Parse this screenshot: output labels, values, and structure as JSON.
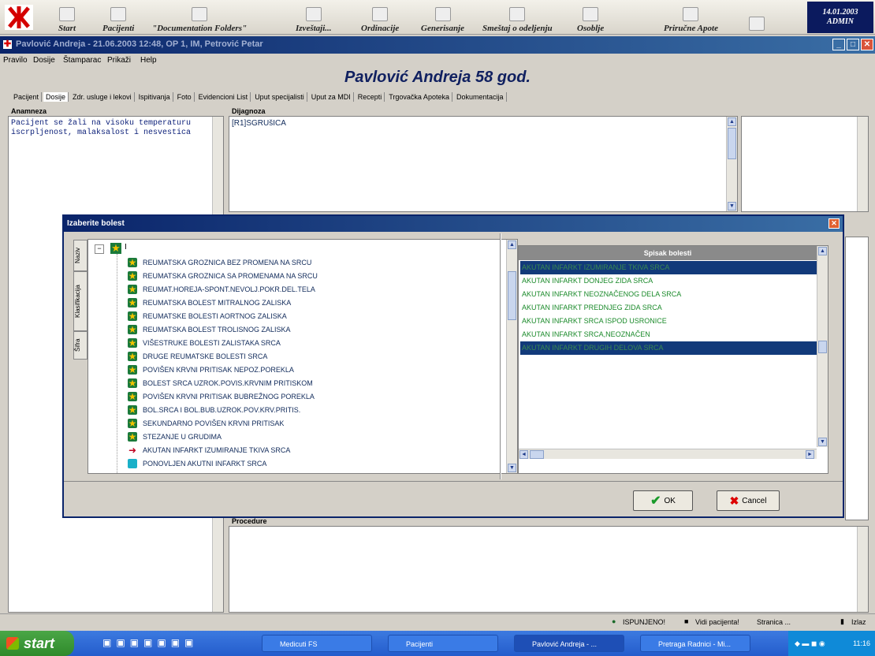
{
  "toolbar": {
    "items": [
      "Start",
      "Pacijenti",
      "\"Documentation Folders\"",
      "Izveštaji...",
      "Ordinacije",
      "Generisanje",
      "Smeštaj o odeljenju",
      "Osoblje",
      "Priručne Apote"
    ],
    "date": "14.01.2003",
    "user": "ADMIN"
  },
  "window": {
    "title": "Pavlović Andreja - 21.06.2003 12:48, OP 1, IM, Petrović Petar",
    "menu": [
      "Pravilo",
      "Dosije",
      "Štamparac",
      "Prikaži",
      "Help"
    ]
  },
  "patient_header": "Pavlović Andreja  58 god.",
  "tabs": [
    "Pacijent",
    "Dosije",
    "Zdr. usluge i lekovi",
    "Ispitivanja",
    "Foto",
    "Evidencioni List",
    "Uput specijalisti",
    "Uput za MDI",
    "Recepti",
    "Trgovačka Apoteka",
    "Dokumentacija"
  ],
  "anamneza": {
    "label": "Anamneza",
    "text": "Pacijent se žali na visoku temperaturu iscrpljenost, malaksalost i nesvestica"
  },
  "dijagnoza": {
    "label": "Dijagnoza",
    "text": "[R1]SGRUšICA"
  },
  "terapija_label": "Procedure",
  "dialog": {
    "title": "Izaberite bolest",
    "side_tabs": [
      "Naziv",
      "Klasifikacija",
      "Šifra"
    ],
    "tree_root": "I",
    "tree_items": [
      "REUMATSKA GROZNICA BEZ PROMENA NA SRCU",
      "REUMATSKA GROZNICA SA PROMENAMA NA SRCU",
      "REUMAT.HOREJA-SPONT.NEVOLJ.POKR.DEL.TELA",
      "REUMATSKA BOLEST MITRALNOG ZALISKA",
      "REUMATSKE BOLESTI AORTNOG ZALISKA",
      "REUMATSKA BOLEST TROLISNOG ZALISKA",
      "VIŠESTRUKE BOLESTI ZALISTAKA SRCA",
      "DRUGE REUMATSKE BOLESTI SRCA",
      "POVIŠEN KRVNI PRITISAK NEPOZ.POREKLA",
      "BOLEST SRCA UZROK.POVIS.KRVNIM PRITISKOM",
      "POVIŠEN KRVNI PRITISAK BUBREŽNOG POREKLA",
      "BOL.SRCA I BOL.BUB.UZROK.POV.KRV.PRITIS.",
      "SEKUNDARNO POVIŠEN KRVNI PRITISAK",
      "STEZANJE U GRUDIMA",
      "AKUTAN INFARKT IZUMIRANJE TKIVA SRCA",
      "PONOVLJEN AKUTNI INFARKT SRCA"
    ],
    "list_header": "Spisak bolesti",
    "list_items": [
      "AKUTAN INFARKT IZUMIRANJE TKIVA SRCA",
      "AKUTAN INFARKT DONJEG ZIDA SRCA",
      "AKUTAN INFARKT NEOZNAČENOG DELA SRCA",
      "AKUTAN INFARKT PREDNJEG ZIDA SRCA",
      "AKUTAN INFARKT SRCA ISPOD USRONICE",
      "AKUTAN INFARKT SRCA,NEOZNAČEN",
      "AKUTAN INFARKT DRUGIH DELOVA SRCA"
    ],
    "ok_label": "OK",
    "cancel_label": "Cancel"
  },
  "statusbar": {
    "items": [
      "ISPUNJENO!",
      "Vidi pacijenta!",
      "Stranica ...",
      "Izlaz"
    ]
  },
  "taskbar": {
    "start": "start",
    "tasks": [
      "Medicuti FS",
      "Pacijenti",
      "Pavlović Andreja - ...",
      "Pretraga Radnici - Mi..."
    ],
    "clock": "11:16"
  }
}
